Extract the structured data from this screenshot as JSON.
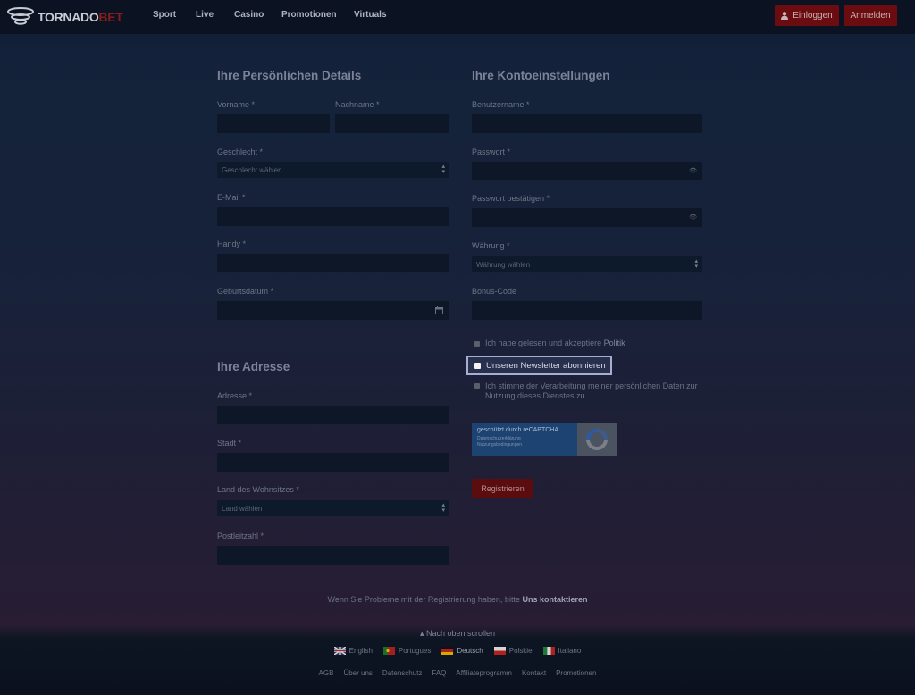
{
  "header": {
    "logo": {
      "part1": "TORNADO",
      "part2": "BET"
    },
    "nav": [
      "Sport",
      "Live",
      "Casino",
      "Promotionen",
      "Virtuals"
    ],
    "login_label": "Einloggen",
    "register_label": "Anmelden"
  },
  "personal": {
    "title": "Ihre Persönlichen Details",
    "firstname_label": "Vorname *",
    "lastname_label": "Nachname *",
    "gender_label": "Geschlecht *",
    "gender_value": "Geschlecht wählen",
    "email_label": "E-Mail *",
    "phone_label": "Handy *",
    "birthdate_label": "Geburtsdatum *"
  },
  "address": {
    "title": "Ihre Adresse",
    "address_label": "Adresse *",
    "city_label": "Stadt *",
    "country_label": "Land des Wohnsitzes *",
    "country_value": "Land wählen",
    "zip_label": "Postleitzahl *"
  },
  "account": {
    "title": "Ihre Kontoeinstellungen",
    "username_label": "Benutzername *",
    "password_label": "Passwort *",
    "password_confirm_label": "Passwort bestätigen *",
    "currency_label": "Währung *",
    "currency_value": "Währung wählen",
    "bonus_label": "Bonus-Code",
    "policy_text": "Ich habe gelesen und akzeptiere",
    "policy_link": "Politik",
    "newsletter_text": "Unseren Newsletter abonnieren",
    "consent_line1": "Ich stimme der Verarbeitung meiner persönlichen Daten zur",
    "consent_line2": "Nutzung dieses Dienstes zu",
    "captcha_title": "geschützt durch reCAPTCHA",
    "captcha_privacy": "Datenschutzerklärung",
    "captcha_terms": "Nutzungsbedingungen",
    "register_button": "Registrieren"
  },
  "help": {
    "text": "Wenn Sie Probleme mit der Registrierung haben, bitte",
    "link": "Uns kontaktieren"
  },
  "footer": {
    "scroll_top": "Nach oben scrollen",
    "languages": [
      "English",
      "Portugues",
      "Deutsch",
      "Polskie",
      "Italiano"
    ],
    "links": [
      "AGB",
      "Über uns",
      "Datenschutz",
      "FAQ",
      "Affiliateprogramm",
      "Kontakt",
      "Promotionen"
    ]
  },
  "colors": {
    "brand_red": "#6b0c10",
    "highlight_border": "#a9aed0"
  }
}
